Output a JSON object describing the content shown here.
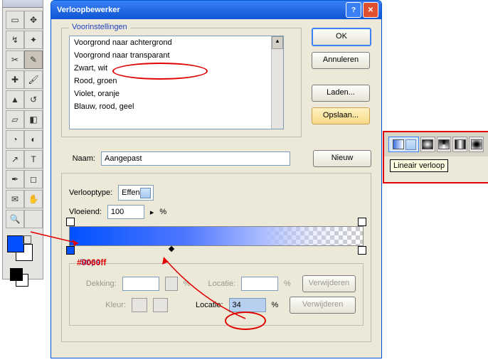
{
  "dialog": {
    "title": "Verloopbewerker",
    "presets": {
      "legend": "Voorinstellingen",
      "items": [
        "Voorgrond naar achtergrond",
        "Voorgrond naar transparant",
        "Zwart, wit",
        "Rood, groen",
        "Violet, oranje",
        "Blauw, rood, geel"
      ]
    },
    "buttons": {
      "ok": "OK",
      "cancel": "Annuleren",
      "load": "Laden...",
      "save": "Opslaan...",
      "new": "Nieuw",
      "delete": "Verwijderen"
    },
    "name": {
      "label": "Naam:",
      "value": "Aangepast"
    },
    "type": {
      "label": "Verlooptype:",
      "value": "Effen"
    },
    "smooth": {
      "label": "Vloeiend:",
      "value": "100",
      "suffix": "%"
    },
    "stops": {
      "legend": "Stops",
      "opacity": {
        "label": "Dekking:",
        "value": "",
        "suffix": "%"
      },
      "location1": {
        "label": "Locatie:",
        "value": "",
        "suffix": "%"
      },
      "color": {
        "label": "Kleur:"
      },
      "location2": {
        "label": "Locatie:",
        "value": "34",
        "suffix": "%"
      }
    }
  },
  "annotations": {
    "hex": "#0060ff"
  },
  "panel": {
    "tooltip": "Lineair verloop"
  }
}
